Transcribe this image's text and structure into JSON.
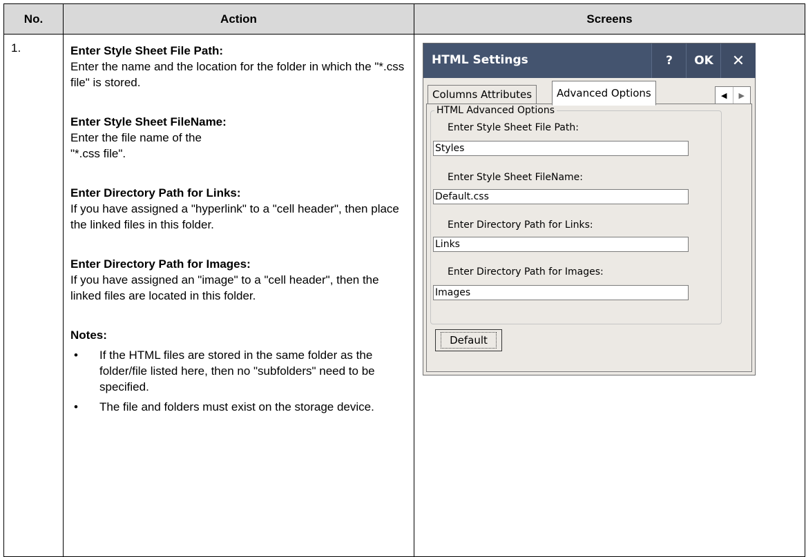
{
  "table": {
    "headers": {
      "no": "No.",
      "action": "Action",
      "screens": "Screens"
    },
    "row1": {
      "number": "1.",
      "sections": [
        {
          "title": "Enter Style Sheet File Path:",
          "text": "Enter the name and the location for the folder in which the \"*.css file\" is stored."
        },
        {
          "title": "Enter Style Sheet FileName:",
          "text1": "Enter the file name of the",
          "text2": "\"*.css file\"."
        },
        {
          "title": "Enter Directory Path for Links:",
          "text": "If you have assigned a \"hyperlink\" to a \"cell header\", then place the linked files in this folder."
        },
        {
          "title": "Enter Directory Path for Images:",
          "text": "If you have assigned an \"image\" to a \"cell header\", then the linked files are located in this folder."
        }
      ],
      "notes_title": "Notes:",
      "notes": [
        "If the HTML files are stored in the same folder as the folder/file listed here, then no \"subfolders\" need to be specified.",
        "The file and folders must exist on the storage device."
      ],
      "bullet": "•"
    }
  },
  "dialog": {
    "title": "HTML Settings",
    "help_label": "?",
    "ok_label": "OK",
    "close_label": "✕",
    "tabs": [
      "Columns Attributes",
      "Advanced Options"
    ],
    "arrow_left": "◀",
    "arrow_right": "▶",
    "group_title": "HTML Advanced Options",
    "fields": [
      {
        "label": "Enter Style Sheet File Path:",
        "value": "Styles"
      },
      {
        "label": "Enter Style Sheet FileName:",
        "value": "Default.css"
      },
      {
        "label": "Enter Directory Path for Links:",
        "value": "Links"
      },
      {
        "label": "Enter Directory Path for Images:",
        "value": "Images"
      }
    ],
    "default_button": "Default",
    "colors": {
      "titlebar": "#44546f",
      "dialog_bg": "#ece9e4"
    }
  }
}
